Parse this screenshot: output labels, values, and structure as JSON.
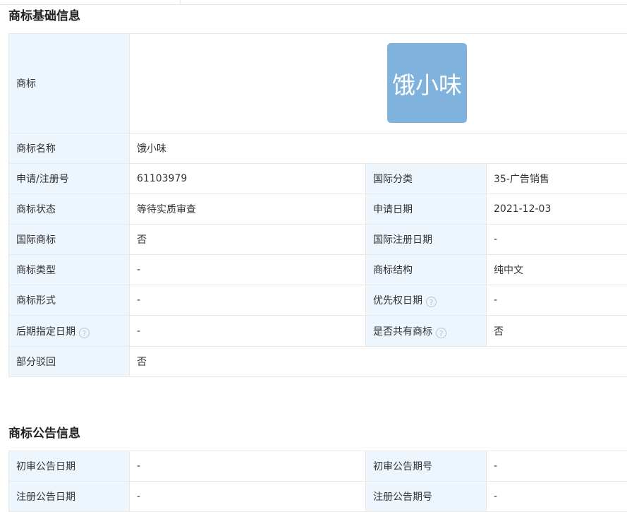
{
  "basic": {
    "title": "商标基础信息",
    "trademark_label": "商标",
    "logo_text": "饿小味",
    "name_label": "商标名称",
    "name_value": "饿小味",
    "rows": [
      {
        "l1": "申请/注册号",
        "v1": "61103979",
        "l2": "国际分类",
        "v2": "35-广告销售"
      },
      {
        "l1": "商标状态",
        "v1": "等待实质审查",
        "l2": "申请日期",
        "v2": "2021-12-03"
      },
      {
        "l1": "国际商标",
        "v1": "否",
        "l2": "国际注册日期",
        "v2": "-"
      },
      {
        "l1": "商标类型",
        "v1": "-",
        "l2": "商标结构",
        "v2": "纯中文"
      },
      {
        "l1": "商标形式",
        "v1": "-",
        "l2": "优先权日期",
        "v2": "-"
      },
      {
        "l1": "后期指定日期",
        "v1": "-",
        "l2": "是否共有商标",
        "v2": "否"
      }
    ],
    "partial_label": "部分驳回",
    "partial_value": "否"
  },
  "notice": {
    "title": "商标公告信息",
    "rows": [
      {
        "l1": "初审公告日期",
        "v1": "-",
        "l2": "初审公告期号",
        "v2": "-"
      },
      {
        "l1": "注册公告日期",
        "v1": "-",
        "l2": "注册公告期号",
        "v2": "-"
      }
    ]
  },
  "help_icon": "question-circle-icon",
  "help_glyph": "?",
  "colors": {
    "label_bg": "#edf5fd",
    "border": "#e8e8e8",
    "logo_bg": "#7fb2dc",
    "text": "#333333"
  }
}
